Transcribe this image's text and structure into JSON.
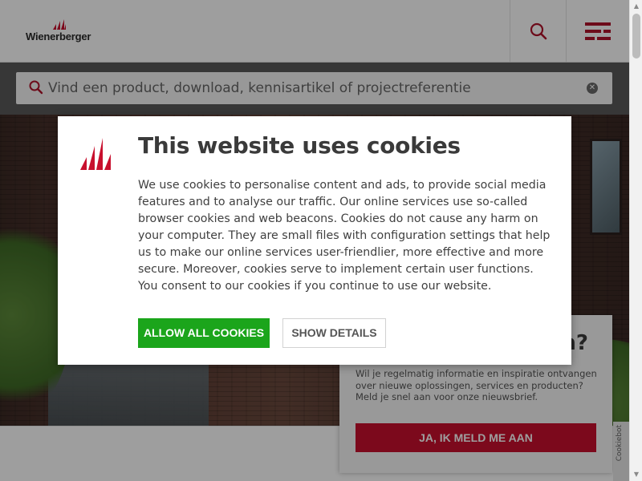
{
  "header": {
    "logo_text": "Wienerberger",
    "search_icon": "search-icon",
    "menu_icon": "menu-icon"
  },
  "search": {
    "placeholder": "Vind een product, download, kennisartikel of projectreferentie",
    "clear_icon": "clear-icon"
  },
  "newsletter": {
    "title_visible": "n?",
    "text": "Wil je regelmatig informatie en inspiratie ontvangen over nieuwe oplossingen, services en producten? Meld je snel aan voor onze nieuwsbrief.",
    "button_label": "JA, IK MELD ME AAN"
  },
  "side_tab": {
    "label": "Cookiebot"
  },
  "cookie_dialog": {
    "title": "This website uses cookies",
    "body": "We use cookies to personalise content and ads, to provide social media features and to analyse our traffic. Our online services use so-called browser cookies and web beacons. Cookies do not cause any harm on your computer. They are small files with configuration settings that help us to make our online services user-friendlier, more effective and more secure. Moreover, cookies serve to implement certain user functions. You consent to our cookies if you continue to use our website.",
    "allow_label": "ALLOW ALL COOKIES",
    "details_label": "SHOW DETAILS"
  },
  "colors": {
    "brand_red": "#c8102e",
    "allow_green": "#1ba51b"
  }
}
